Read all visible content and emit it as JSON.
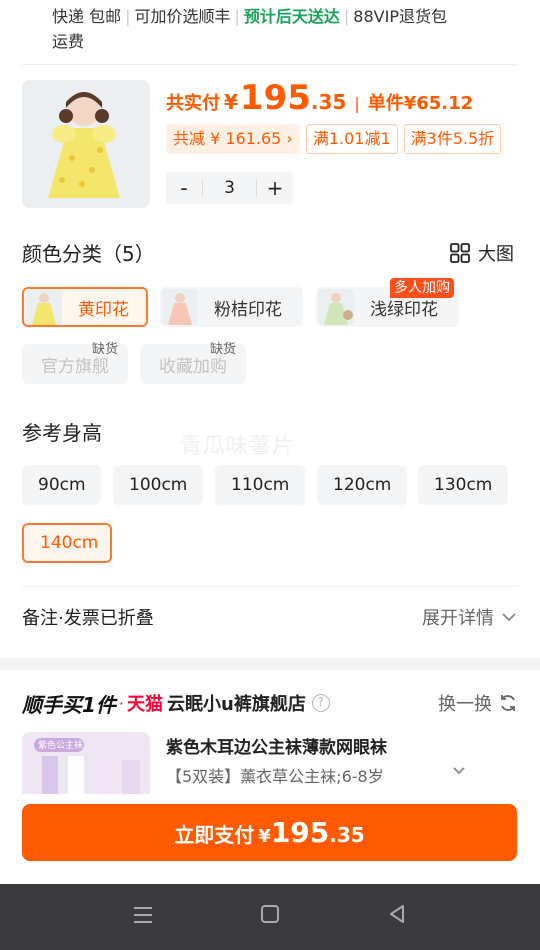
{
  "shipping": {
    "items": [
      "快递 包邮",
      "可加价选顺丰"
    ],
    "green": "预计后天送达",
    "vip": "88VIP退货包",
    "tail": "运费"
  },
  "price": {
    "total_label": "共实付",
    "currency": "¥",
    "total_int": "195",
    "total_dec": ".35",
    "unit_label": "单件",
    "unit_price": "¥65.12"
  },
  "promos": [
    "共减 ¥ 161.65 ›",
    "满1.01减1",
    "满3件5.5折"
  ],
  "quantity": {
    "minus": "-",
    "value": "3",
    "plus": "+"
  },
  "color": {
    "title": "颜色分类（5）",
    "big_view": "大图",
    "options": [
      {
        "label": "黄印花",
        "selected": true
      },
      {
        "label": "粉桔印花",
        "selected": false
      },
      {
        "label": "浅绿印花",
        "selected": false,
        "badge": "多人加购"
      }
    ],
    "disabled": [
      {
        "label": "官方旗舰",
        "tag": "缺货"
      },
      {
        "label": "收藏加购",
        "tag": "缺货"
      }
    ]
  },
  "size": {
    "title": "参考身高",
    "options": [
      "90cm",
      "100cm",
      "110cm",
      "120cm",
      "130cm",
      "140cm"
    ],
    "selected": "140cm"
  },
  "watermark": "青瓜味薯片",
  "note": {
    "left": "备注·发票已折叠",
    "right": "展开详情"
  },
  "addon": {
    "title": "顺手买1件",
    "dot": "·",
    "platform": "天猫",
    "store": "云眠小u裤旗舰店",
    "help": "?",
    "swap": "换一换",
    "product_title": "紫色木耳边公主袜薄款网眼袜",
    "sku": "【5双装】薰衣草公主袜;6-8岁",
    "thumb_text": "紫色公主袜"
  },
  "pay": {
    "label": "立即支付",
    "currency": "¥",
    "int": "195",
    "dec": ".35"
  },
  "colors": {
    "accent": "#ff5a00",
    "green": "#1aa35b",
    "tmall": "#ff0036"
  }
}
